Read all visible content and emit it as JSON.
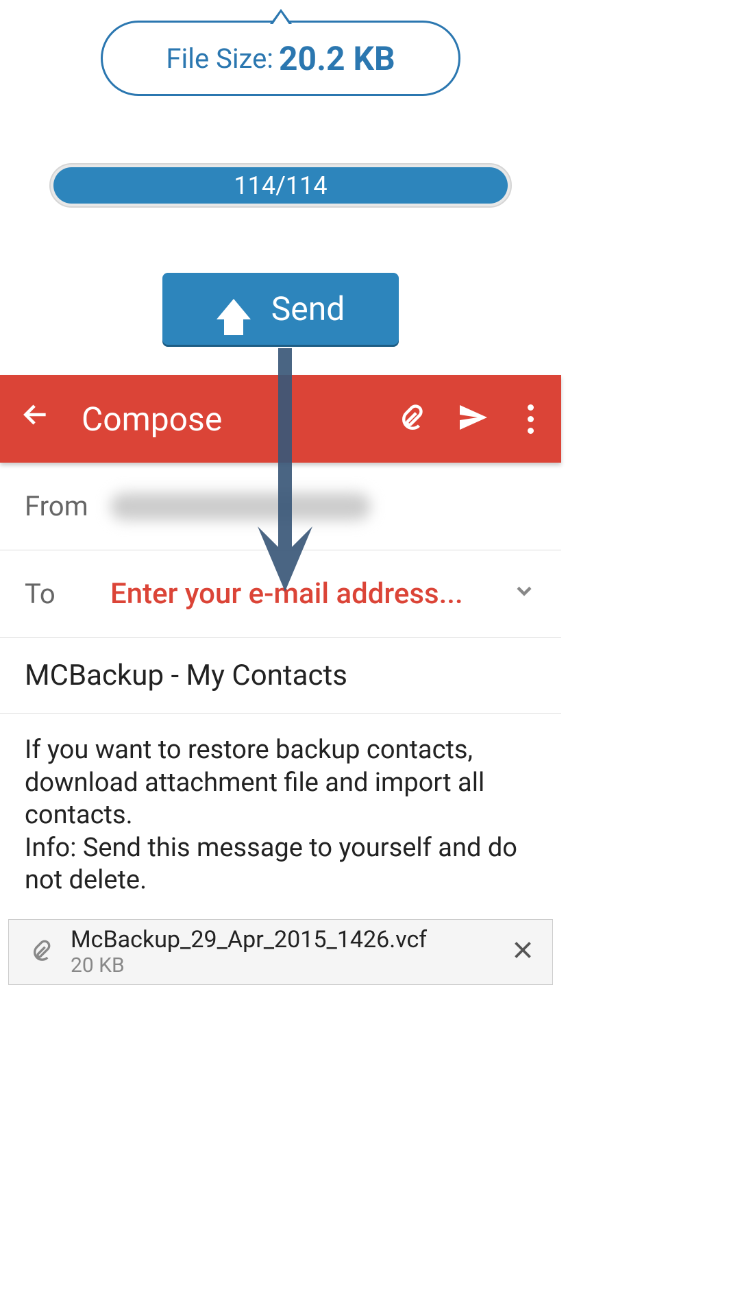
{
  "file_info": {
    "label": "File Size: ",
    "value": "20.2 KB"
  },
  "progress": {
    "text": "114/114"
  },
  "send_button": {
    "label": "Send"
  },
  "gmail": {
    "compose_title": "Compose",
    "from_label": "From",
    "to_label": "To",
    "to_placeholder": "Enter your e-mail address...",
    "subject": "MCBackup - My Contacts",
    "body": "If you want to restore backup contacts, download attachment file and import all contacts.\nInfo: Send this message to yourself and do not delete."
  },
  "attachment": {
    "name": "McBackup_29_Apr_2015_1426.vcf",
    "size": "20 KB"
  }
}
